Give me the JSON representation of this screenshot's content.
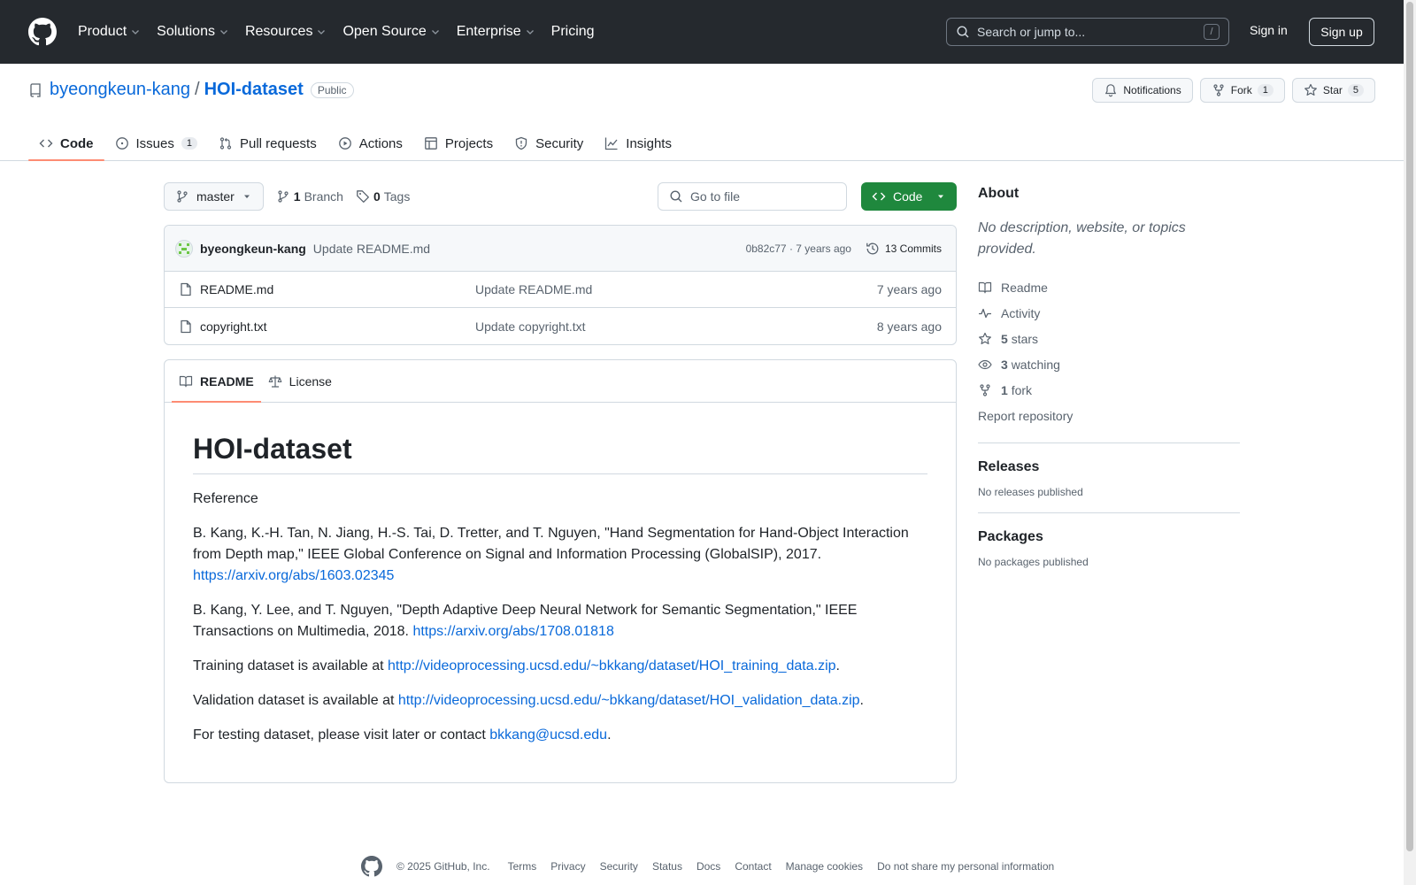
{
  "header": {
    "nav": [
      "Product",
      "Solutions",
      "Resources",
      "Open Source",
      "Enterprise",
      "Pricing"
    ],
    "search_placeholder": "Search or jump to...",
    "search_key": "/",
    "sign_in": "Sign in",
    "sign_up": "Sign up"
  },
  "repo": {
    "owner": "byeongkeun-kang",
    "sep": "/",
    "name": "HOI-dataset",
    "visibility": "Public",
    "notifications": "Notifications",
    "fork_label": "Fork",
    "fork_count": "1",
    "star_label": "Star",
    "star_count": "5",
    "tabs": [
      {
        "label": "Code"
      },
      {
        "label": "Issues",
        "count": "1"
      },
      {
        "label": "Pull requests"
      },
      {
        "label": "Actions"
      },
      {
        "label": "Projects"
      },
      {
        "label": "Security"
      },
      {
        "label": "Insights"
      }
    ]
  },
  "toolbar": {
    "branch": "master",
    "branches_count": "1",
    "branches_label": "Branch",
    "tags_count": "0",
    "tags_label": "Tags",
    "goto_placeholder": "Go to file",
    "code_label": "Code"
  },
  "commit": {
    "author": "byeongkeun-kang",
    "message": "Update README.md",
    "meta": "0b82c77 · 7 years ago",
    "commits": "13 Commits"
  },
  "files": [
    {
      "name": "README.md",
      "commit": "Update README.md",
      "age": "7 years ago"
    },
    {
      "name": "copyright.txt",
      "commit": "Update copyright.txt",
      "age": "8 years ago"
    }
  ],
  "readme": {
    "tab_readme": "README",
    "tab_license": "License",
    "title": "HOI-dataset",
    "reference": "Reference",
    "p1_text": "B. Kang, K.-H. Tan, N. Jiang, H.-S. Tai, D. Tretter, and T. Nguyen, \"Hand Segmentation for Hand-Object Interaction from Depth map,\" IEEE Global Conference on Signal and Information Processing (GlobalSIP), 2017.",
    "p1_link": "https://arxiv.org/abs/1603.02345",
    "p2_text": "B. Kang, Y. Lee, and T. Nguyen, \"Depth Adaptive Deep Neural Network for Semantic Segmentation,\" IEEE Transactions on Multimedia, 2018.",
    "p2_link": "https://arxiv.org/abs/1708.01818",
    "p3_text": "Training dataset is available at",
    "p3_link": "http://videoprocessing.ucsd.edu/~bkkang/dataset/HOI_training_data.zip",
    "p4_text": "Validation dataset is available at",
    "p4_link": "http://videoprocessing.ucsd.edu/~bkkang/dataset/HOI_validation_data.zip",
    "p5_text": "For testing dataset, please visit later or contact",
    "p5_link": "bkkang@ucsd.edu",
    "period": "."
  },
  "sidebar": {
    "about": "About",
    "description": "No description, website, or topics provided.",
    "readme": "Readme",
    "activity": "Activity",
    "stars_count": "5",
    "stars_label": "stars",
    "watching_count": "3",
    "watching_label": "watching",
    "forks_count": "1",
    "forks_label": "fork",
    "report": "Report repository",
    "releases": "Releases",
    "releases_empty": "No releases published",
    "packages": "Packages",
    "packages_empty": "No packages published"
  },
  "footer": {
    "copyright": "© 2025 GitHub, Inc.",
    "links": [
      "Terms",
      "Privacy",
      "Security",
      "Status",
      "Docs",
      "Contact",
      "Manage cookies",
      "Do not share my personal information"
    ]
  },
  "colors": {
    "header_bg": "#25292e",
    "link": "#0969da",
    "code_button": "#1f883d",
    "tab_underline": "#fd8c73"
  }
}
